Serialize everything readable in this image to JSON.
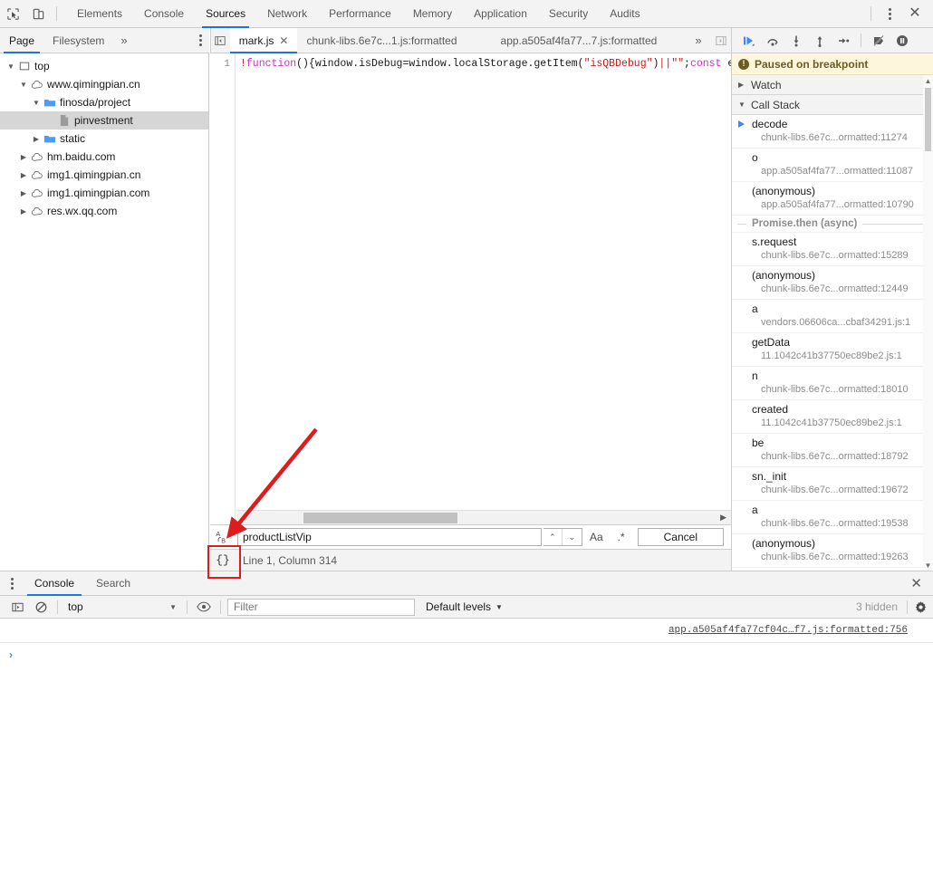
{
  "main_toolbar": {
    "icons": [
      {
        "name": "inspect-element-icon",
        "label": "Inspect element"
      },
      {
        "name": "device-toolbar-icon",
        "label": "Toggle device toolbar"
      }
    ],
    "panels": [
      {
        "label": "Elements",
        "active": false
      },
      {
        "label": "Console",
        "active": false
      },
      {
        "label": "Sources",
        "active": true
      },
      {
        "label": "Network",
        "active": false
      },
      {
        "label": "Performance",
        "active": false
      },
      {
        "label": "Memory",
        "active": false
      },
      {
        "label": "Application",
        "active": false
      },
      {
        "label": "Security",
        "active": false
      },
      {
        "label": "Audits",
        "active": false
      }
    ],
    "more_label": "⋮",
    "close_label": "✕"
  },
  "navigator": {
    "tabs": [
      {
        "label": "Page",
        "active": true
      },
      {
        "label": "Filesystem",
        "active": false
      }
    ],
    "more_label": "»",
    "kebab_label": "⋮",
    "tree": [
      {
        "label": "top",
        "depth": 0,
        "icon": "frame-icon",
        "expanded": true,
        "selected": false
      },
      {
        "label": "www.qimingpian.cn",
        "depth": 1,
        "icon": "cloud-icon",
        "expanded": true,
        "selected": false
      },
      {
        "label": "finosda/project",
        "depth": 2,
        "icon": "folder-icon",
        "expanded": true,
        "selected": false
      },
      {
        "label": "pinvestment",
        "depth": 3,
        "icon": "file-icon",
        "expanded": null,
        "selected": true
      },
      {
        "label": "static",
        "depth": 2,
        "icon": "folder-icon",
        "expanded": false,
        "selected": false
      },
      {
        "label": "hm.baidu.com",
        "depth": 1,
        "icon": "cloud-icon",
        "expanded": false,
        "selected": false
      },
      {
        "label": "img1.qimingpian.cn",
        "depth": 1,
        "icon": "cloud-icon",
        "expanded": false,
        "selected": false
      },
      {
        "label": "img1.qimingpian.com",
        "depth": 1,
        "icon": "cloud-icon",
        "expanded": false,
        "selected": false
      },
      {
        "label": "res.wx.qq.com",
        "depth": 1,
        "icon": "cloud-icon",
        "expanded": false,
        "selected": false
      }
    ]
  },
  "editor": {
    "pane_toggle_label": "◀",
    "tabs": [
      {
        "label": "mark.js",
        "active": true,
        "closable": true
      },
      {
        "label": "chunk-libs.6e7c...1.js:formatted",
        "active": false,
        "closable": false
      },
      {
        "label": "app.a505af4fa77...7.js:formatted",
        "active": false,
        "closable": false
      }
    ],
    "tabs_more_label": "»",
    "show_navigator_label": "▶",
    "line_number": "1",
    "code_tokens": [
      {
        "text": "!",
        "type": "op"
      },
      {
        "text": "function",
        "type": "kw"
      },
      {
        "text": "(){window.isDebug=window.localStorage.getItem(",
        "type": "plain"
      },
      {
        "text": "\"isQBDebug\"",
        "type": "str"
      },
      {
        "text": "||",
        "type": "op"
      },
      {
        "text": "\"\"",
        "type": "str"
      },
      {
        "text": ";",
        "type": "plain"
      },
      {
        "text": "const",
        "type": "kw"
      },
      {
        "text": " e=",
        "type": "plain"
      },
      {
        "text": "`$",
        "type": "str"
      }
    ],
    "close_tab_label": "✕"
  },
  "search": {
    "case_icon_label": "Aᴮ",
    "value": "productListVip",
    "placeholder": "",
    "prev_label": "⌃",
    "next_label": "⌄",
    "match_case_label": "Aa",
    "regex_label": ".*",
    "cancel_label": "Cancel"
  },
  "status_bar": {
    "pretty_print_label": "{}",
    "cursor_position": "Line 1, Column 314"
  },
  "debugger": {
    "toolbar_icons": [
      {
        "name": "resume-script-icon",
        "label": "Resume script execution"
      },
      {
        "name": "step-over-icon",
        "label": "Step over next function call"
      },
      {
        "name": "step-into-icon",
        "label": "Step into next function call"
      },
      {
        "name": "step-out-icon",
        "label": "Step out of current function"
      },
      {
        "name": "step-icon",
        "label": "Step"
      },
      {
        "name": "deactivate-breakpoints-icon",
        "label": "Deactivate breakpoints"
      },
      {
        "name": "pause-on-exceptions-icon",
        "label": "Pause on exceptions"
      }
    ],
    "paused_banner": "Paused on breakpoint",
    "watch_label": "Watch",
    "call_stack_label": "Call Stack",
    "call_stack": [
      {
        "fn": "decode",
        "loc": "chunk-libs.6e7c...ormatted:11274",
        "active": true,
        "type": "frame"
      },
      {
        "fn": "o",
        "loc": "app.a505af4fa77...ormatted:11087",
        "active": false,
        "type": "frame"
      },
      {
        "fn": "(anonymous)",
        "loc": "app.a505af4fa77...ormatted:10790",
        "active": false,
        "type": "frame"
      },
      {
        "fn": "Promise.then (async)",
        "loc": "",
        "active": false,
        "type": "async"
      },
      {
        "fn": "s.request",
        "loc": "chunk-libs.6e7c...ormatted:15289",
        "active": false,
        "type": "frame"
      },
      {
        "fn": "(anonymous)",
        "loc": "chunk-libs.6e7c...ormatted:12449",
        "active": false,
        "type": "frame"
      },
      {
        "fn": "a",
        "loc": "vendors.06606ca...cbaf34291.js:1",
        "active": false,
        "type": "frame"
      },
      {
        "fn": "getData",
        "loc": "11.1042c41b37750ec89be2.js:1",
        "active": false,
        "type": "frame"
      },
      {
        "fn": "n",
        "loc": "chunk-libs.6e7c...ormatted:18010",
        "active": false,
        "type": "frame"
      },
      {
        "fn": "created",
        "loc": "11.1042c41b37750ec89be2.js:1",
        "active": false,
        "type": "frame"
      },
      {
        "fn": "be",
        "loc": "chunk-libs.6e7c...ormatted:18792",
        "active": false,
        "type": "frame"
      },
      {
        "fn": "sn._init",
        "loc": "chunk-libs.6e7c...ormatted:19672",
        "active": false,
        "type": "frame"
      },
      {
        "fn": "a",
        "loc": "chunk-libs.6e7c...ormatted:19538",
        "active": false,
        "type": "frame"
      },
      {
        "fn": "(anonymous)",
        "loc": "chunk-libs.6e7c...ormatted:19263",
        "active": false,
        "type": "frame"
      }
    ]
  },
  "drawer": {
    "kebab_label": "⋮",
    "tabs": [
      {
        "label": "Console",
        "active": true
      },
      {
        "label": "Search",
        "active": false
      }
    ],
    "close_label": "✕",
    "filters": {
      "sidebar_toggle_name": "console-sidebar-icon",
      "clear_label": "clear-console-icon",
      "context": "top",
      "context_caret": "▼",
      "eye_label": "live-expression-icon",
      "filter_placeholder": "Filter",
      "filter_value": "",
      "levels_label": "Default levels",
      "levels_caret": "▼",
      "hidden_count": "3 hidden",
      "settings_label": "console-settings-icon"
    },
    "messages": [
      {
        "link": "app.a505af4fa77cf04c…f7.js:formatted:756"
      }
    ],
    "prompt_caret": "›"
  },
  "annotations": {
    "arrow_color": "#e01b1b",
    "highlight_color": "#e01b1b"
  },
  "colors": {
    "accent": "#1a73e8",
    "toolbar_bg": "#f3f3f3",
    "border": "#cdcdcd",
    "paused_bg": "#fdf6dd",
    "paused_fg": "#6b5c20",
    "keyword": "#c830c8",
    "string": "#c41a16",
    "selection": "#d6d6d6"
  }
}
